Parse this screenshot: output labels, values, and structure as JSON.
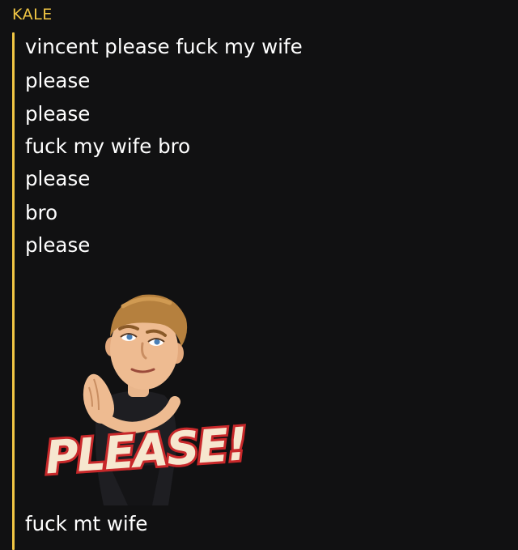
{
  "chat": {
    "sender": "KALE",
    "messages": [
      "vincent please fuck my wife",
      "please",
      "please",
      "fuck my wife bro",
      "please",
      "bro",
      "please"
    ],
    "sticker": {
      "caption": "PLEASE!"
    },
    "last_message": "fuck mt wife"
  },
  "colors": {
    "background": "#111112",
    "accent": "#f1c644",
    "text": "#ffffff",
    "sticker_text": "#f6e7cf",
    "sticker_outline": "#c8282a"
  }
}
